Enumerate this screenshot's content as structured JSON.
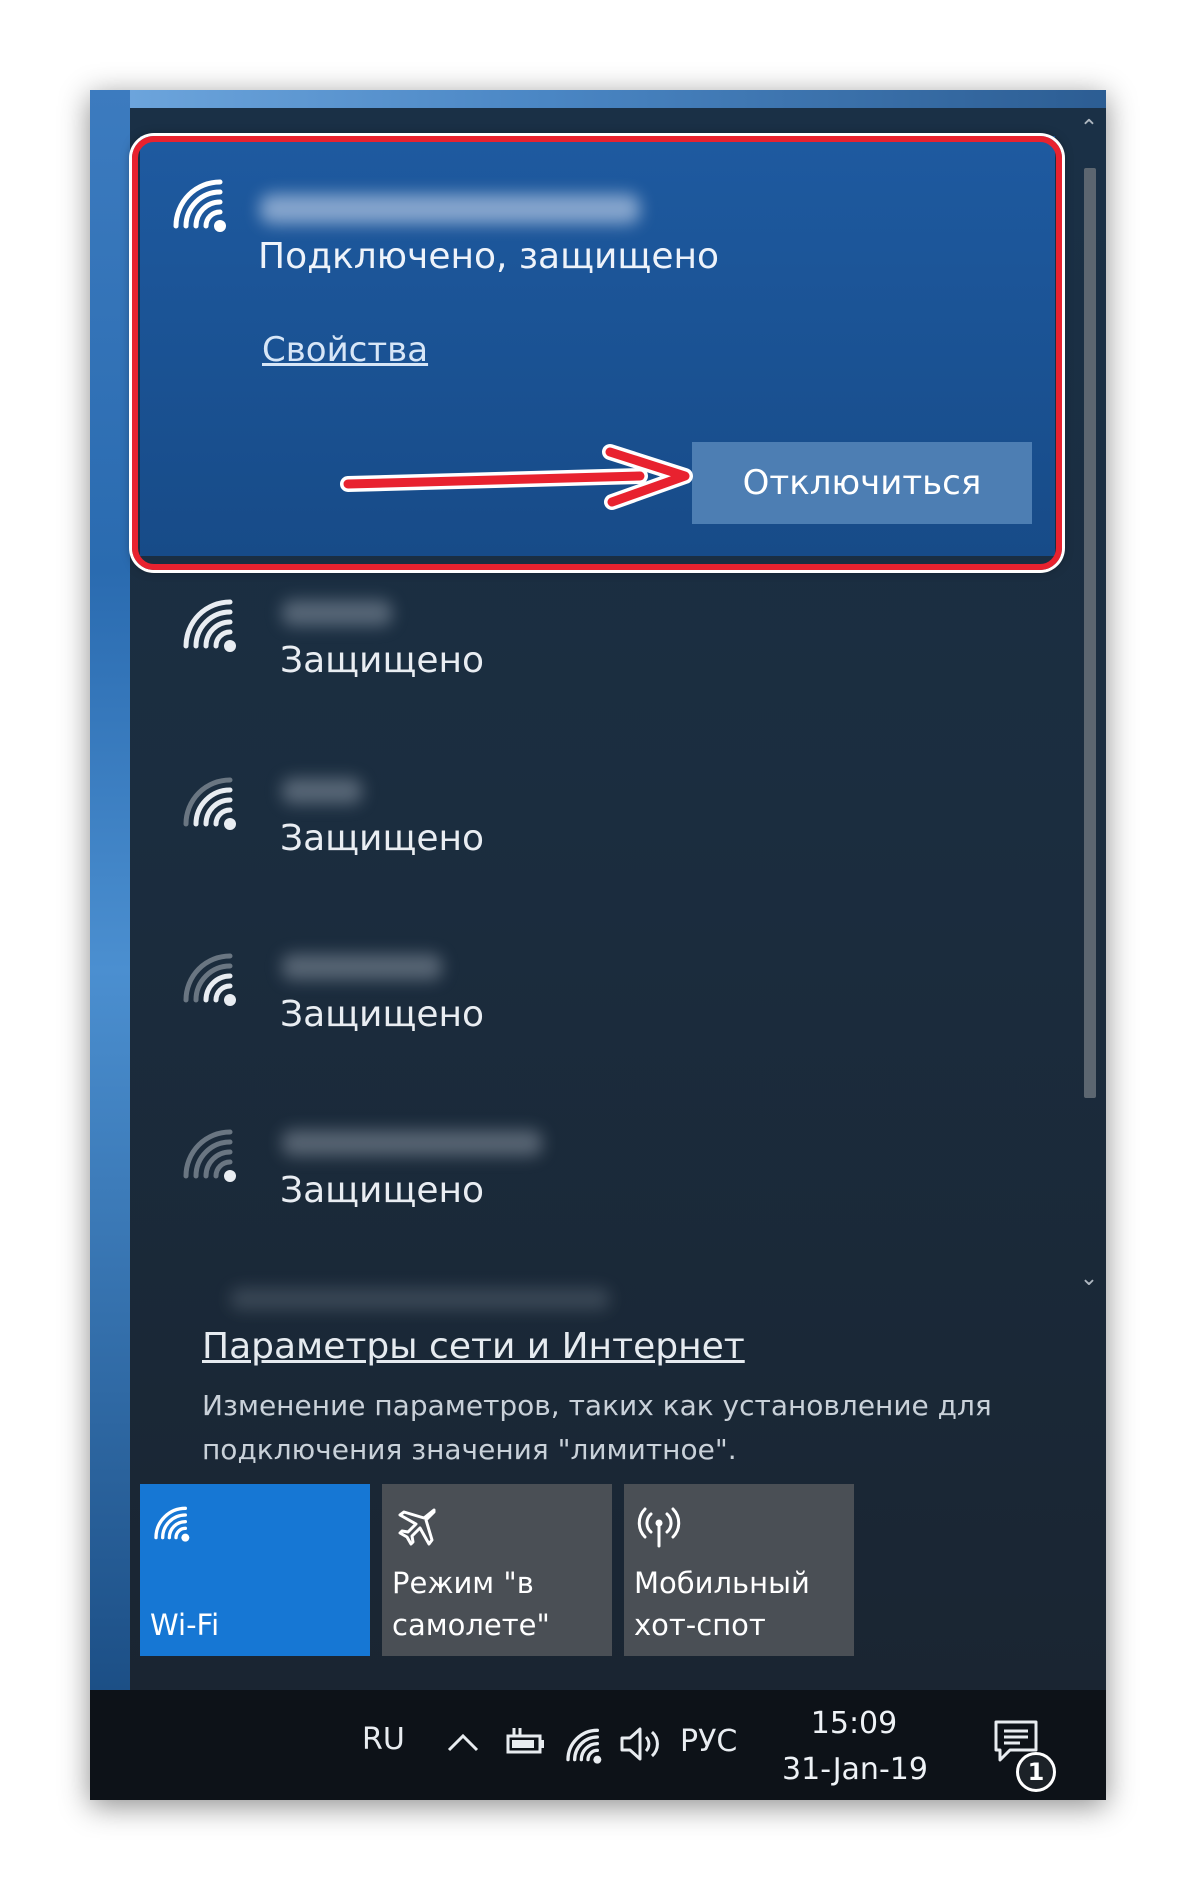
{
  "connected_network": {
    "status": "Подключено, защищено",
    "properties_label": "Свойства",
    "disconnect_label": "Отключиться"
  },
  "networks": [
    {
      "status": "Защищено"
    },
    {
      "status": "Защищено"
    },
    {
      "status": "Защищено"
    },
    {
      "status": "Защищено"
    }
  ],
  "settings": {
    "link": "Параметры сети и Интернет",
    "description": "Изменение параметров, таких как установление для подключения значения \"лимитное\"."
  },
  "quick_actions": [
    {
      "label": "Wi-Fi",
      "icon": "wifi-icon",
      "active": true
    },
    {
      "label": "Режим \"в\nсамолете\"",
      "icon": "airplane-icon",
      "active": false
    },
    {
      "label": "Мобильный\nхот-спот",
      "icon": "hotspot-icon",
      "active": false
    }
  ],
  "taskbar": {
    "language": "RU",
    "input_lang": "РУС",
    "time": "15:09",
    "date": "31-Jan-19",
    "notification_count": "1"
  },
  "colors": {
    "highlight": "#e8222f",
    "active_tile": "#1677d4",
    "connected_card": "#1e5aa0"
  }
}
